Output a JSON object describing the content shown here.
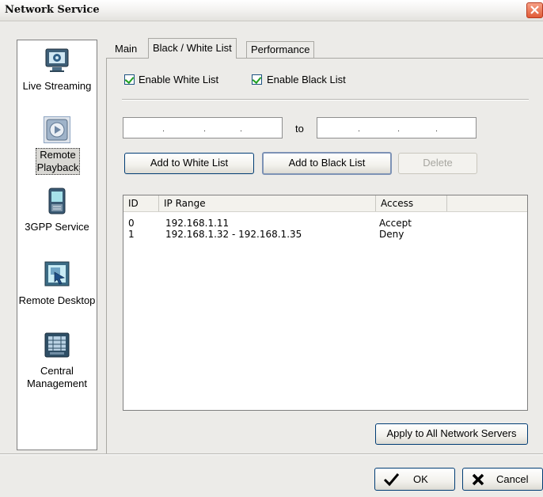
{
  "window": {
    "title": "Network Service"
  },
  "nav": {
    "items": [
      {
        "label": "Live Streaming",
        "icon": "monitor-icon",
        "selected": false
      },
      {
        "label": "Remote Playback",
        "icon": "playback-icon",
        "selected": true
      },
      {
        "label": "3GPP Service",
        "icon": "mobile-phone-icon",
        "selected": false
      },
      {
        "label": "Remote Desktop",
        "icon": "remote-desktop-icon",
        "selected": false
      },
      {
        "label": "Central Management",
        "icon": "server-rack-icon",
        "selected": false
      }
    ]
  },
  "tabs": [
    "Main",
    "Black / White List",
    "Performance"
  ],
  "active_tab": "Black / White List",
  "checkboxes": {
    "white": {
      "label": "Enable White List",
      "checked": true
    },
    "black": {
      "label": "Enable Black List",
      "checked": true
    }
  },
  "ip_range": {
    "from_value": ". . .",
    "to_label": "to",
    "to_value": ". . ."
  },
  "buttons": {
    "add_white": "Add to White List",
    "add_black": "Add to Black List",
    "delete": "Delete",
    "apply_all": "Apply to All Network Servers",
    "ok": "OK",
    "cancel": "Cancel"
  },
  "table": {
    "columns": [
      "ID",
      "IP Range",
      "Access"
    ],
    "rows": [
      {
        "id": "0",
        "ip_range": "192.168.1.11",
        "access": "Accept"
      },
      {
        "id": "1",
        "ip_range": "192.168.1.32 - 192.168.1.35",
        "access": "Deny"
      }
    ]
  },
  "colors": {
    "accent_green": "#21a121",
    "close_red": "#e05a37",
    "border_blue": "#003c74"
  }
}
